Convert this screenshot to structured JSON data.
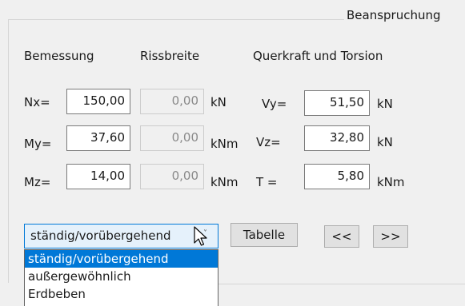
{
  "group": {
    "title": "Beanspruchung"
  },
  "headers": {
    "bemessung": "Bemessung",
    "rissbreite": "Rissbreite",
    "querkraft": "Querkraft und Torsion"
  },
  "rows": {
    "nx": {
      "label": "Nx=",
      "value": "150,00",
      "riss": "0,00",
      "unit": "kN"
    },
    "my": {
      "label": "My=",
      "value": "37,60",
      "riss": "0,00",
      "unit": "kNm"
    },
    "mz": {
      "label": "Mz=",
      "value": "14,00",
      "riss": "0,00",
      "unit": "kNm"
    },
    "vy": {
      "label": "Vy=",
      "value": "51,50",
      "unit": "kN"
    },
    "vz": {
      "label": "Vz=",
      "value": "32,80",
      "unit": "kN"
    },
    "t": {
      "label": "T =",
      "value": "5,80",
      "unit": "kNm"
    }
  },
  "controls": {
    "combo_value": "ständig/vorübergehend",
    "combo_arrow": "˅",
    "tabelle": "Tabelle",
    "prev": "<<",
    "next": ">>"
  },
  "dropdown": {
    "options": [
      "ständig/vorübergehend",
      "außergewöhnlich",
      "Erdbeben"
    ],
    "selected_index": 0
  },
  "colors": {
    "selection": "#0078d7",
    "background": "#f0f0f0"
  },
  "icons": {
    "cursor": "mouse-pointer-icon"
  }
}
